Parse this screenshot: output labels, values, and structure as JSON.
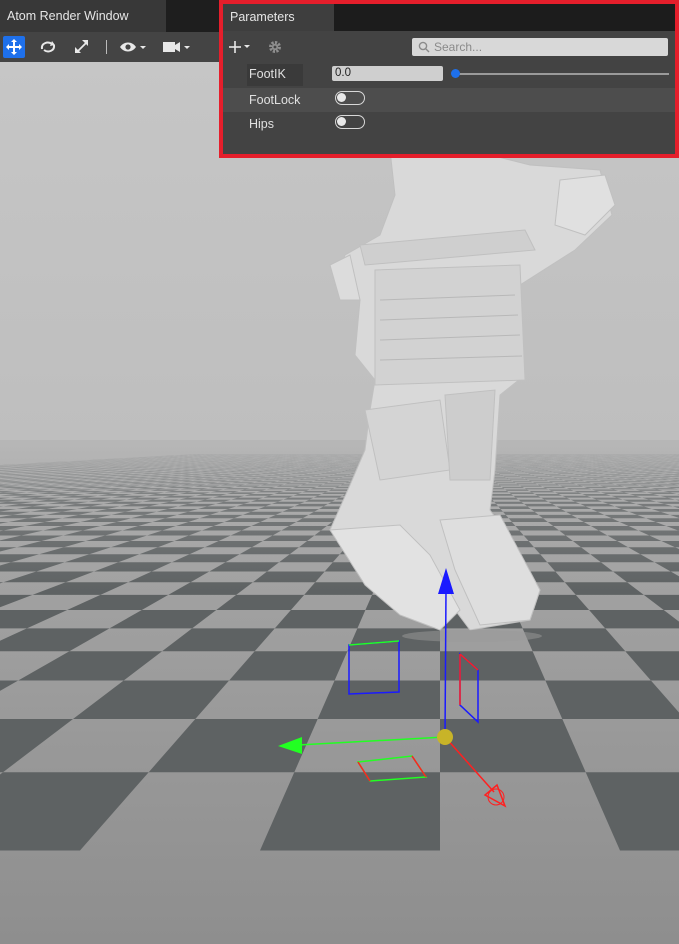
{
  "window": {
    "title": "Atom Render Window"
  },
  "toolbar": {
    "tools": [
      {
        "icon": "move-icon",
        "active": true
      },
      {
        "icon": "rotate-icon",
        "active": false
      },
      {
        "icon": "scale-icon",
        "active": false
      }
    ],
    "view_menu_icon": "eye-icon",
    "camera_menu_icon": "camera-icon"
  },
  "parameters_panel": {
    "tab_label": "Parameters",
    "add_icon": "plus-icon",
    "settings_icon": "gear-icon",
    "search_placeholder": "Search...",
    "params": [
      {
        "name": "FootIK",
        "type": "float",
        "value": "0.0",
        "slider_fraction": 0.0
      },
      {
        "name": "FootLock",
        "type": "bool",
        "value": false
      },
      {
        "name": "Hips",
        "type": "bool",
        "value": false
      }
    ],
    "highlight_color": "#e51e2b"
  },
  "scene": {
    "sky_color": "#bdbdbd",
    "floor_light": "#a8a8a8",
    "floor_dark": "#5c5f60",
    "character": "armored samurai figure",
    "gizmo_colors": {
      "x": "#ff2020",
      "y": "#22ff22",
      "z": "#1a1aff",
      "center": "#c8b428"
    }
  },
  "accent": "#1e70eb"
}
